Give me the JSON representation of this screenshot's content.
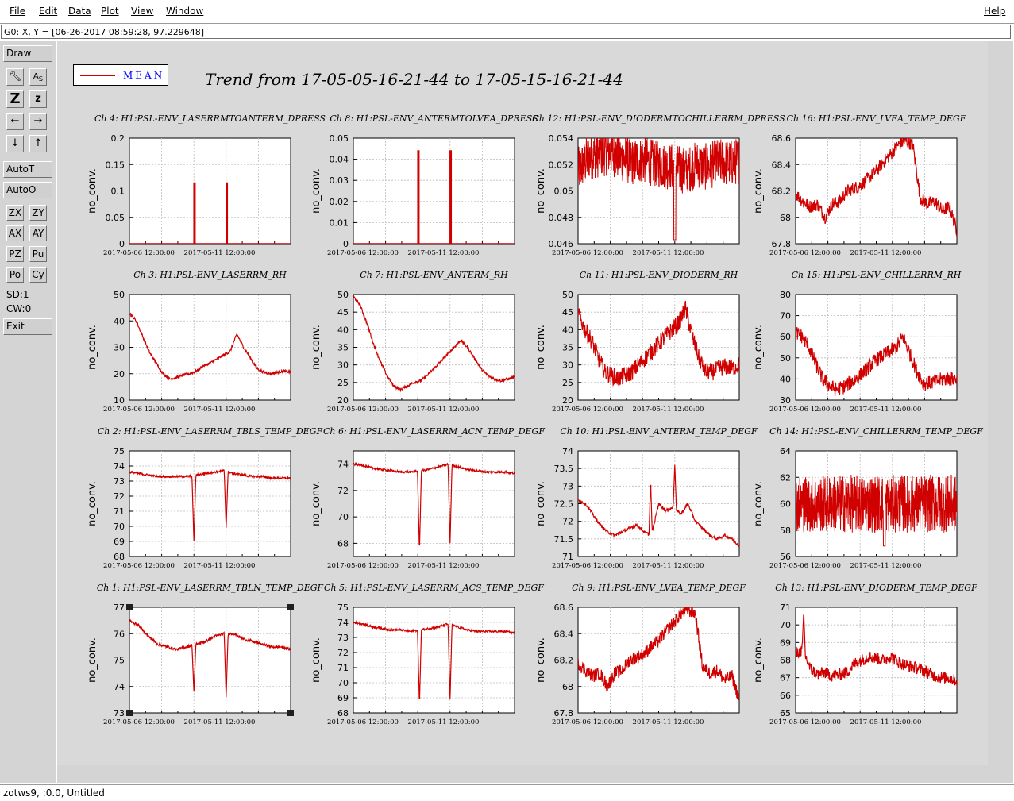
{
  "menubar": {
    "items": [
      {
        "name": "menu-file",
        "label": "File"
      },
      {
        "name": "menu-edit",
        "label": "Edit"
      },
      {
        "name": "menu-data",
        "label": "Data"
      },
      {
        "name": "menu-plot",
        "label": "Plot"
      },
      {
        "name": "menu-view",
        "label": "View"
      },
      {
        "name": "menu-window",
        "label": "Window"
      }
    ],
    "help": "Help"
  },
  "coord_readout": "G0: X, Y = [06-26-2017 08:59:28, 97.229648]",
  "toolbar": {
    "draw": "Draw",
    "autot": "AutoT",
    "autoo": "AutoO",
    "zx": "ZX",
    "zy": "ZY",
    "ax": "AX",
    "ay": "AY",
    "pz": "PZ",
    "pu": "Pu",
    "po": "Po",
    "cy": "Cy",
    "sd": "SD:1",
    "cw": "CW:0",
    "exit": "Exit",
    "z_big": "Z",
    "z_small": "z"
  },
  "status_text": "zotws9, :0.0, Untitled",
  "legend": {
    "label": "MEAN",
    "color": "#d00000"
  },
  "title": "Trend from 17-05-05-16-21-44 to 17-05-15-16-21-44",
  "chart_data": [
    {
      "type": "line",
      "title": "Ch 4: H1:PSL-ENV_LASERRMTOANTERM_DPRESS",
      "ylabel": "no_conv.",
      "ylim": [
        0,
        0.2
      ],
      "yticks": [
        "0",
        "0.05",
        "0.1",
        "0.15",
        "0.2"
      ],
      "xticks": [
        "2017-05-06 12:00:00",
        "2017-05-11 12:00:00"
      ],
      "shape": "spikes",
      "base": 0,
      "noise": 0,
      "spike_x": [
        0.4,
        0.6
      ],
      "spike_y": 0.115,
      "series": [
        {
          "values": []
        }
      ]
    },
    {
      "type": "line",
      "title": "Ch 8: H1:PSL-ENV_ANTERMTOLVEA_DPRESS",
      "ylabel": "no_conv.",
      "ylim": [
        0,
        0.05
      ],
      "yticks": [
        "0",
        "0.01",
        "0.02",
        "0.03",
        "0.04",
        "0.05"
      ],
      "xticks": [
        "2017-05-06 12:00:00",
        "2017-05-11 12:00:00"
      ],
      "shape": "spikes",
      "base": 0,
      "noise": 0,
      "spike_x": [
        0.4,
        0.6
      ],
      "spike_y": 0.044,
      "series": [
        {
          "values": []
        }
      ]
    },
    {
      "type": "line",
      "title": "Ch 12: H1:PSL-ENV_DIODERMTOCHILLERRM_DPRESS",
      "ylabel": "no_conv.",
      "ylim": [
        0.046,
        0.054
      ],
      "yticks": [
        "0.046",
        "0.048",
        "0.05",
        "0.052",
        "0.054"
      ],
      "xticks": [
        "2017-05-06 12:00:00",
        "2017-05-11 12:00:00"
      ],
      "shape": "band",
      "base": 0.0522,
      "noise": 0.0018,
      "dip_x": 0.6,
      "dip_y": 0.0463,
      "series": [
        {
          "values": [
            0.0515,
            0.0526,
            0.0528,
            0.053,
            0.0525,
            0.0522,
            0.0524,
            0.0521,
            0.0519,
            0.0518,
            0.0515,
            0.052,
            0.0518,
            0.0522,
            0.0521,
            0.0523
          ]
        }
      ]
    },
    {
      "type": "line",
      "title": "Ch 16: H1:PSL-ENV_LVEA_TEMP_DEGF",
      "ylabel": "no_conv.",
      "ylim": [
        67.8,
        68.6
      ],
      "yticks": [
        "67.8",
        "68",
        "68.2",
        "68.4",
        "68.6"
      ],
      "xticks": [
        "2017-05-06 12:00:00",
        "2017-05-11 12:00:00"
      ],
      "shape": "line",
      "noise": 0.05,
      "series": [
        {
          "values": [
            68.18,
            68.12,
            68.08,
            68.1,
            68.0,
            68.1,
            68.12,
            68.2,
            68.22,
            68.25,
            68.3,
            68.35,
            68.42,
            68.48,
            68.55,
            68.58,
            68.55,
            68.15,
            68.1,
            68.12,
            68.05,
            68.08,
            67.9
          ]
        }
      ]
    },
    {
      "type": "line",
      "title": "Ch 3: H1:PSL-ENV_LASERRM_RH",
      "ylabel": "no_conv.",
      "ylim": [
        10,
        50
      ],
      "yticks": [
        "10",
        "20",
        "30",
        "40",
        "50"
      ],
      "xticks": [
        "2017-05-06 12:00:00",
        "2017-05-11 12:00:00"
      ],
      "shape": "line",
      "noise": 0.5,
      "series": [
        {
          "values": [
            43,
            40,
            34,
            28,
            24,
            20,
            18,
            18.5,
            19.5,
            20,
            21,
            23,
            24,
            25.5,
            27,
            28.5,
            35,
            30,
            26,
            22,
            20.5,
            20,
            20.5,
            21,
            20.5
          ]
        }
      ]
    },
    {
      "type": "line",
      "title": "Ch 7: H1:PSL-ENV_ANTERM_RH",
      "ylabel": "no_conv.",
      "ylim": [
        20,
        50
      ],
      "yticks": [
        "20",
        "25",
        "30",
        "35",
        "40",
        "45",
        "50"
      ],
      "xticks": [
        "2017-05-06 12:00:00",
        "2017-05-11 12:00:00"
      ],
      "shape": "line",
      "noise": 0.4,
      "series": [
        {
          "values": [
            49.5,
            47,
            42,
            36,
            31,
            27,
            24,
            23,
            24,
            25,
            25.5,
            27,
            29,
            31,
            33,
            35,
            37,
            35,
            32,
            29,
            27,
            26,
            25.5,
            26,
            26.5
          ]
        }
      ]
    },
    {
      "type": "line",
      "title": "Ch 11: H1:PSL-ENV_DIODERM_RH",
      "ylabel": "no_conv.",
      "ylim": [
        20,
        50
      ],
      "yticks": [
        "20",
        "25",
        "30",
        "35",
        "40",
        "45",
        "50"
      ],
      "xticks": [
        "2017-05-06 12:00:00",
        "2017-05-11 12:00:00"
      ],
      "shape": "line",
      "noise": 2.5,
      "series": [
        {
          "values": [
            45,
            40,
            37,
            32,
            28,
            27,
            26,
            27,
            28,
            30,
            32,
            34,
            36,
            38,
            40,
            42,
            46,
            38,
            32,
            28,
            28,
            29,
            29.5,
            29,
            30
          ]
        }
      ]
    },
    {
      "type": "line",
      "title": "Ch 15: H1:PSL-ENV_CHILLERRM_RH",
      "ylabel": "no_conv.",
      "ylim": [
        30,
        80
      ],
      "yticks": [
        "30",
        "40",
        "50",
        "60",
        "70",
        "80"
      ],
      "xticks": [
        "2017-05-06 12:00:00",
        "2017-05-11 12:00:00"
      ],
      "shape": "line",
      "noise": 3.5,
      "series": [
        {
          "values": [
            62,
            60,
            55,
            47,
            40,
            37,
            35,
            36,
            38,
            40,
            43,
            46,
            49,
            51,
            53,
            55,
            60,
            52,
            44,
            38,
            38,
            39,
            40,
            40,
            40
          ]
        }
      ]
    },
    {
      "type": "line",
      "title": "Ch 2: H1:PSL-ENV_LASERRM_TBLS_TEMP_DEGF",
      "ylabel": "no_conv.",
      "ylim": [
        68,
        75
      ],
      "yticks": [
        "68",
        "69",
        "70",
        "71",
        "72",
        "73",
        "74",
        "75"
      ],
      "xticks": [
        "2017-05-06 12:00:00",
        "2017-05-11 12:00:00"
      ],
      "shape": "line",
      "noise": 0.07,
      "dips": [
        {
          "x": 0.4,
          "y": 69.0
        },
        {
          "x": 0.6,
          "y": 69.9
        }
      ],
      "series": [
        {
          "values": [
            73.6,
            73.5,
            73.4,
            73.3,
            73.3,
            73.3,
            73.3,
            73.4,
            73.5,
            73.6,
            73.7,
            73.5,
            73.4,
            73.3,
            73.3,
            73.2,
            73.2,
            73.2
          ]
        }
      ]
    },
    {
      "type": "line",
      "title": "Ch 6: H1:PSL-ENV_LASERRM_ACN_TEMP_DEGF",
      "ylabel": "no_conv.",
      "ylim": [
        67,
        75
      ],
      "yticks": [
        "68",
        "70",
        "72",
        "74"
      ],
      "xticks": [
        "2017-05-06 12:00:00",
        "2017-05-11 12:00:00"
      ],
      "shape": "line",
      "noise": 0.08,
      "dips": [
        {
          "x": 0.41,
          "y": 67.3
        },
        {
          "x": 0.6,
          "y": 68.0
        }
      ],
      "series": [
        {
          "values": [
            74.0,
            73.9,
            73.7,
            73.6,
            73.5,
            73.4,
            73.4,
            73.5,
            73.6,
            73.8,
            74.0,
            73.8,
            73.6,
            73.5,
            73.4,
            73.4,
            73.4,
            73.3
          ]
        }
      ]
    },
    {
      "type": "line",
      "title": "Ch 10: H1:PSL-ENV_ANTERM_TEMP_DEGF",
      "ylabel": "no_conv.",
      "ylim": [
        71,
        74
      ],
      "yticks": [
        "71",
        "71.5",
        "72",
        "72.5",
        "73",
        "73.5",
        "74"
      ],
      "xticks": [
        "2017-05-06 12:00:00",
        "2017-05-11 12:00:00"
      ],
      "shape": "line",
      "noise": 0.04,
      "spikes_up": [
        {
          "x": 0.45,
          "y": 73.2
        },
        {
          "x": 0.6,
          "y": 73.6
        }
      ],
      "series": [
        {
          "values": [
            72.6,
            72.5,
            72.2,
            71.9,
            71.7,
            71.6,
            71.7,
            71.8,
            71.9,
            71.7,
            71.6,
            72.5,
            72.3,
            72.4,
            72.2,
            72.5,
            72.0,
            71.8,
            71.6,
            71.5,
            71.6,
            71.5,
            71.3
          ]
        }
      ]
    },
    {
      "type": "line",
      "title": "Ch 14: H1:PSL-ENV_CHILLERRM_TEMP_DEGF",
      "ylabel": "no_conv.",
      "ylim": [
        56,
        64
      ],
      "yticks": [
        "56",
        "58",
        "60",
        "62",
        "64"
      ],
      "xticks": [
        "2017-05-06 12:00:00",
        "2017-05-11 12:00:00"
      ],
      "shape": "band",
      "base": 60,
      "noise": 2.2,
      "dip_x": 0.55,
      "dip_y": 56.8,
      "series": [
        {
          "values": [
            60,
            60,
            60,
            60,
            60,
            60,
            60,
            60,
            60,
            60,
            60,
            60
          ]
        }
      ]
    },
    {
      "type": "line",
      "title": "Ch 1: H1:PSL-ENV_LASERRM_TBLN_TEMP_DEGF",
      "ylabel": "no_conv.",
      "ylim": [
        73,
        77
      ],
      "yticks": [
        "73",
        "74",
        "75",
        "76",
        "77"
      ],
      "xticks": [
        "2017-05-06 12:00:00",
        "2017-05-11 12:00:00"
      ],
      "shape": "line",
      "noise": 0.05,
      "selected": true,
      "dips": [
        {
          "x": 0.4,
          "y": 73.8
        },
        {
          "x": 0.6,
          "y": 73.6
        }
      ],
      "series": [
        {
          "values": [
            76.5,
            76.3,
            75.9,
            75.6,
            75.5,
            75.4,
            75.5,
            75.6,
            75.7,
            75.9,
            76.0,
            76.0,
            75.8,
            75.7,
            75.6,
            75.5,
            75.5,
            75.4
          ]
        }
      ]
    },
    {
      "type": "line",
      "title": "Ch 5: H1:PSL-ENV_LASERRM_ACS_TEMP_DEGF",
      "ylabel": "no_conv.",
      "ylim": [
        68,
        75
      ],
      "yticks": [
        "68",
        "69",
        "70",
        "71",
        "72",
        "73",
        "74",
        "75"
      ],
      "xticks": [
        "2017-05-06 12:00:00",
        "2017-05-11 12:00:00"
      ],
      "shape": "line",
      "noise": 0.07,
      "dips": [
        {
          "x": 0.41,
          "y": 68.5
        },
        {
          "x": 0.6,
          "y": 68.9
        }
      ],
      "series": [
        {
          "values": [
            74.0,
            73.9,
            73.7,
            73.6,
            73.5,
            73.5,
            73.4,
            73.5,
            73.6,
            73.7,
            73.9,
            73.7,
            73.5,
            73.4,
            73.4,
            73.4,
            73.4,
            73.3
          ]
        }
      ]
    },
    {
      "type": "line",
      "title": "Ch 9: H1:PSL-ENV_LVEA_TEMP_DEGF",
      "ylabel": "no_conv.",
      "ylim": [
        67.8,
        68.6
      ],
      "yticks": [
        "67.8",
        "68",
        "68.2",
        "68.4",
        "68.6"
      ],
      "xticks": [
        "2017-05-06 12:00:00",
        "2017-05-11 12:00:00"
      ],
      "shape": "line",
      "noise": 0.05,
      "series": [
        {
          "values": [
            68.18,
            68.12,
            68.08,
            68.1,
            68.0,
            68.1,
            68.12,
            68.2,
            68.22,
            68.25,
            68.3,
            68.35,
            68.42,
            68.48,
            68.55,
            68.58,
            68.55,
            68.15,
            68.1,
            68.12,
            68.05,
            68.08,
            67.9
          ]
        }
      ]
    },
    {
      "type": "line",
      "title": "Ch 13: H1:PSL-ENV_DIODERM_TEMP_DEGF",
      "ylabel": "no_conv.",
      "ylim": [
        65,
        71
      ],
      "yticks": [
        "65",
        "66",
        "67",
        "68",
        "69",
        "70",
        "71"
      ],
      "xticks": [
        "2017-05-06 12:00:00",
        "2017-05-11 12:00:00"
      ],
      "shape": "line",
      "noise": 0.35,
      "spikes_up": [
        {
          "x": 0.05,
          "y": 70.8
        }
      ],
      "series": [
        {
          "values": [
            68.3,
            68.6,
            67.5,
            67.2,
            67.3,
            67.1,
            67.2,
            67.3,
            67.8,
            68.0,
            68.2,
            68.1,
            68.0,
            68.2,
            67.9,
            67.7,
            67.6,
            67.5,
            67.3,
            67.1,
            67.0,
            67.0,
            66.8
          ]
        }
      ]
    }
  ]
}
